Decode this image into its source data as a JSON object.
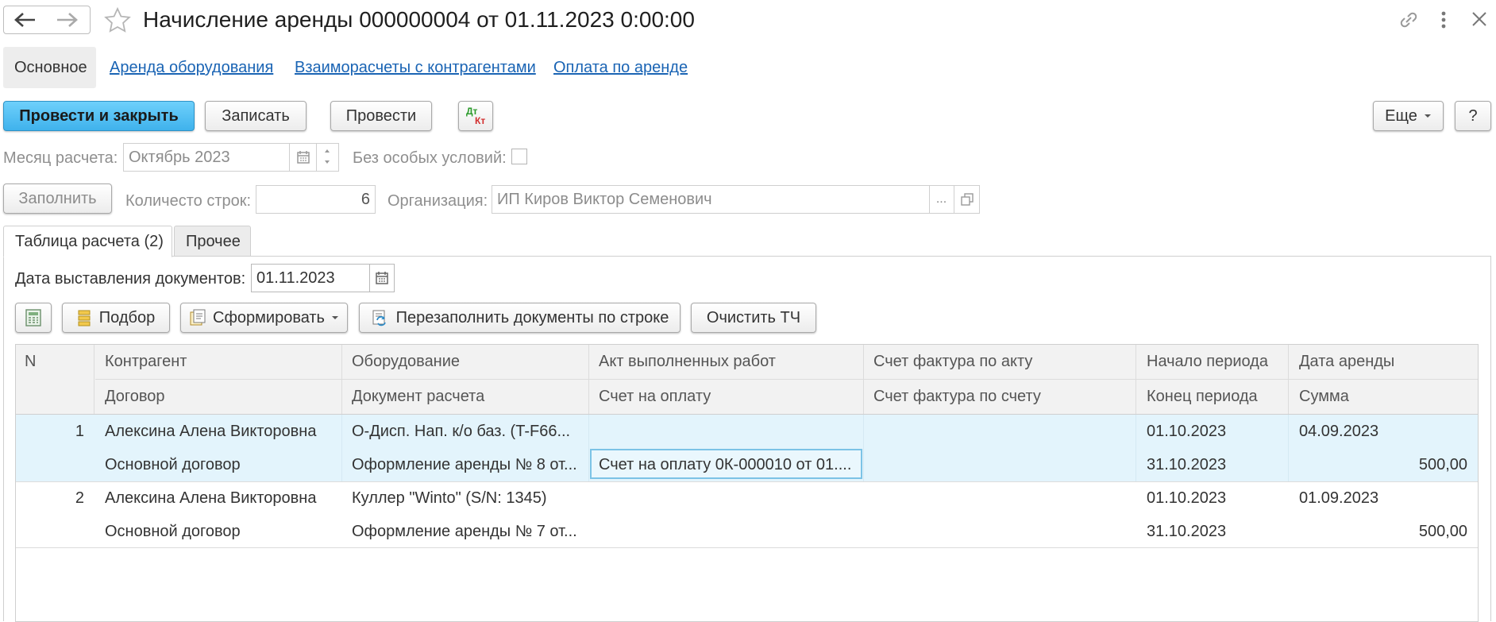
{
  "window": {
    "title": "Начисление аренды 000000004 от 01.11.2023 0:00:00"
  },
  "nav_tabs": [
    {
      "label": "Основное"
    },
    {
      "label": "Аренда оборудования"
    },
    {
      "label": "Взаиморасчеты с контрагентами"
    },
    {
      "label": "Оплата по аренде"
    }
  ],
  "toolbar": {
    "post_close": "Провести и закрыть",
    "save": "Записать",
    "post": "Провести",
    "dtkt_top": "Дт",
    "dtkt_bottom": "Кт",
    "more": "Еще",
    "help": "?"
  },
  "form": {
    "month_label": "Месяц расчета:",
    "month_value": "Октябрь 2023",
    "no_special_label": "Без особых условий:",
    "fill_button": "Заполнить",
    "rows_count_label": "Количесто строк:",
    "rows_count_value": "6",
    "org_label": "Организация:",
    "org_value": "ИП Киров Виктор Семенович",
    "org_ellipsis": "..."
  },
  "inner_tabs": [
    {
      "label": "Таблица расчета (2)"
    },
    {
      "label": "Прочее"
    }
  ],
  "doc_date": {
    "label": "Дата выставления документов:",
    "value": "01.11.2023"
  },
  "table_toolbar": {
    "pick": "Подбор",
    "generate": "Сформировать",
    "refill": "Перезаполнить документы по строке",
    "clear": "Очистить ТЧ"
  },
  "table": {
    "headers_row1": [
      "N",
      "Контрагент",
      "Оборудование",
      "Акт выполненных работ",
      "Счет фактура по акту",
      "Начало периода",
      "Дата аренды"
    ],
    "headers_row2": [
      "",
      "Договор",
      "Документ расчета",
      "Счет на оплату",
      "Счет фактура по счету",
      "Конец периода",
      "Сумма"
    ],
    "rows": [
      {
        "n": "1",
        "counterparty": "Алексина Алена Викторовна",
        "contract": "Основной договор",
        "equipment": "О-Дисп. Нап. к/о баз. (T-F66...",
        "calc_doc": "Оформление аренды № 8 от...",
        "act": "",
        "invoice": "Счет на оплату 0К-000010 от 01....",
        "vat_act": "",
        "vat_invoice": "",
        "period_start": "01.10.2023",
        "period_end": "31.10.2023",
        "rent_date": "04.09.2023",
        "amount": "500,00"
      },
      {
        "n": "2",
        "counterparty": "Алексина Алена Викторовна",
        "contract": "Основной договор",
        "equipment": "Куллер \"Winto\" (S/N: 1345)",
        "calc_doc": "Оформление аренды № 7 от...",
        "act": "",
        "invoice": "",
        "vat_act": "",
        "vat_invoice": "",
        "period_start": "01.10.2023",
        "period_end": "31.10.2023",
        "rent_date": "01.09.2023",
        "amount": "500,00"
      }
    ]
  },
  "colors": {
    "primary_button": "#4fbef3",
    "link": "#1a64b4",
    "selected_row": "#e3f4fc",
    "selected_cell_border": "#7cc3e6",
    "header_bg": "#f2f2f2"
  }
}
